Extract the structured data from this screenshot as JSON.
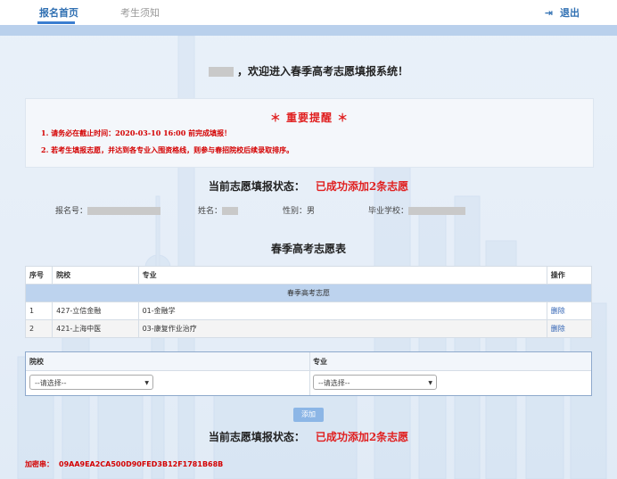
{
  "nav": {
    "tabs": [
      "报名首页",
      "考生须知"
    ],
    "logout_label": "退出",
    "logout_icon": "sign-out-icon"
  },
  "welcome": {
    "text": "，欢迎进入春季高考志愿填报系统！"
  },
  "notice": {
    "title": "＊ 重要提醒 ＊",
    "items": [
      "1. 请务必在截止时间：2020-03-10 16:00 前完成填报！",
      "2. 若考生填报志愿，并达到各专业入围资格线，则参与春招院校后续录取排序。"
    ]
  },
  "status": {
    "label": "当前志愿填报状态：",
    "value": "已成功添加2条志愿"
  },
  "student": {
    "reg_label": "报名号：",
    "name_label": "姓名：",
    "gender_label": "性别：",
    "gender_value": "男",
    "school_label": "毕业学校："
  },
  "wishes": {
    "title": "春季高考志愿表",
    "headers": [
      "序号",
      "院校",
      "专业",
      "操作"
    ],
    "group_label": "春季高考志愿",
    "rows": [
      {
        "no": "1",
        "school": "427-立信金融",
        "major": "01-金融学",
        "action": "删除"
      },
      {
        "no": "2",
        "school": "421-上海中医",
        "major": "03-康复作业治疗",
        "action": "删除"
      }
    ]
  },
  "form": {
    "school_label": "院校",
    "major_label": "专业",
    "school_select": "--请选择--",
    "major_select": "--请选择--",
    "add_label": "添加"
  },
  "encrypt": {
    "label": "加密串：",
    "code": "09AA9EA2CA500D90FED3B12F1781B68B"
  },
  "colors": {
    "accent": "#2f6fb2",
    "alert": "#e02020",
    "table_group": "#bdd3ee"
  }
}
